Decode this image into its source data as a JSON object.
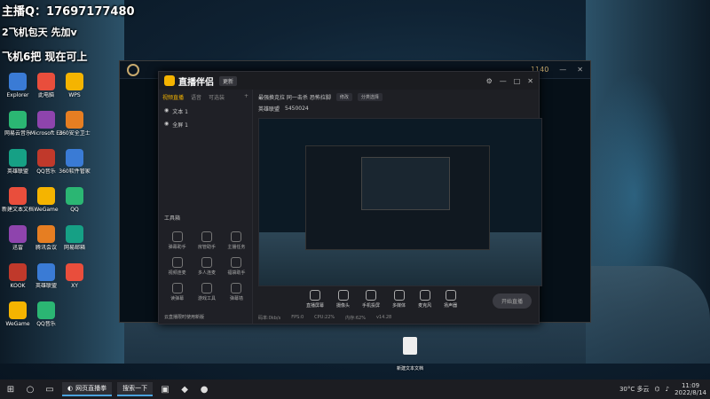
{
  "overlay": {
    "line1": "主播Q：17697177480",
    "line2": "2飞机包天 先加v",
    "line3": "飞机6把 现在可上"
  },
  "desktop": {
    "icons": [
      {
        "label": "Explorer"
      },
      {
        "label": "此电脑"
      },
      {
        "label": "WPS"
      },
      {
        "label": "网易云音乐"
      },
      {
        "label": "Microsoft Edge"
      },
      {
        "label": "360安全卫士"
      },
      {
        "label": "英雄联盟"
      },
      {
        "label": "QQ音乐"
      },
      {
        "label": "360软件管家"
      },
      {
        "label": "新建文本文档"
      },
      {
        "label": "WeGame"
      },
      {
        "label": "QQ"
      },
      {
        "label": "迅雷"
      },
      {
        "label": "腾讯会议"
      },
      {
        "label": "网易邮箱"
      },
      {
        "label": "KOOK"
      },
      {
        "label": "英雄联盟"
      },
      {
        "label": "XY"
      },
      {
        "label": "WeGame"
      },
      {
        "label": "QQ音乐"
      }
    ],
    "file_label": "新建文本文档"
  },
  "lol_client": {
    "coins": "1140"
  },
  "streamer_app": {
    "name": "直播伴侣",
    "version_chip": "更新",
    "left_tabs": [
      "视频直播",
      "语音",
      "可选装"
    ],
    "scenes": [
      "文本 1",
      "全屏 1"
    ],
    "tools_title": "工具箱",
    "tools": [
      {
        "label": "弹幕助手"
      },
      {
        "label": "房管助手"
      },
      {
        "label": "主播任务"
      },
      {
        "label": "视频连麦"
      },
      {
        "label": "多人连麦"
      },
      {
        "label": "福袋助手"
      },
      {
        "label": "读弹幕"
      },
      {
        "label": "游戏工具"
      },
      {
        "label": "弹幕墙"
      }
    ],
    "left_footer": "云直播限时使用新版",
    "info_title": "最强换克拉 同一击杀 恐怖拉脚",
    "info_chips": [
      "修改",
      "分类选择"
    ],
    "meta_game": "英雄联盟",
    "meta_id": "5450024",
    "actions": [
      {
        "label": "直播屏幕"
      },
      {
        "label": "摄像头"
      },
      {
        "label": "手机投屏"
      },
      {
        "label": "多媒体"
      },
      {
        "label": "麦克风"
      },
      {
        "label": "扬声器"
      }
    ],
    "live_button": "开始直播",
    "status": [
      "码率:0kb/s",
      "FPS:0",
      "CPU:22%",
      "内存:62%",
      "v14.28"
    ]
  },
  "taskbar": {
    "app_label": "网页直播拳",
    "app2_label": "搜索一下",
    "weather": "30°C 多云",
    "time": "11:09",
    "date": "2022/8/14"
  }
}
